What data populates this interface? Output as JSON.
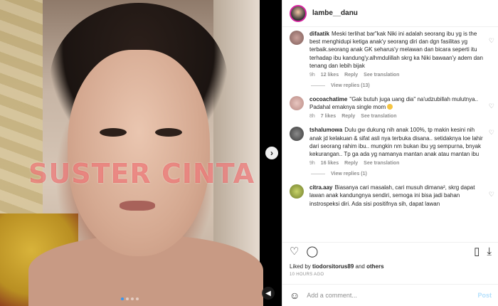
{
  "media": {
    "watermark": "SUSTER CINTA",
    "next_icon": "chevron-right-icon",
    "mute_icon": "speaker-muted-icon",
    "carousel_dots": 4,
    "active_dot": 0
  },
  "header": {
    "username": "lambe__danu"
  },
  "comments": [
    {
      "user": "difaatik",
      "text": "Meski terlihat bar\"kak Niki ini adalah seorang ibu yg is the best menghidupi ketiga anak'y seorang diri dan dgn fasilitas yg terbaik.seorang anak GK seharus'y melawan dan bicara seperti itu terhadap ibu kandung'y.alhmdulillah skrg ka Niki bawaan'y adem dan tenang dan lebih bijak",
      "time": "9h",
      "likes": "12 likes",
      "reply": "Reply",
      "translate": "See translation",
      "view_replies": "View replies (13)"
    },
    {
      "user": "cocoachatime",
      "text": "\"Gak butuh juga uang dia\" na'udzubillah mulutnya.. Padahal emaknya single mom",
      "time": "8h",
      "likes": "7 likes",
      "reply": "Reply",
      "translate": "See translation",
      "view_replies": ""
    },
    {
      "user": "tshalumowa",
      "text": "Dulu gw dukung nih anak 100%, tp makin kesini nih anak jd kelakuan & sifat asli nya terbuka disana.. setidaknya loe lahir dari seorang rahim ibu.. mungkin nm bukan ibu yg sempurna, bnyak kekurangan.. Tp ga ada yg namanya mantan anak atau mantan ibu",
      "time": "9h",
      "likes": "16 likes",
      "reply": "Reply",
      "translate": "See translation",
      "view_replies": "View replies (1)"
    },
    {
      "user": "citra.aay",
      "text": "Biasanya cari masalah, cari musuh dimana², skrg dapat lawan anak kandungnya sendiri, semoga ini bisa jadi bahan instrospeksi diri. Ada sisi positifnya sih, dapat lawan",
      "time": "",
      "likes": "",
      "reply": "",
      "translate": "",
      "view_replies": ""
    }
  ],
  "actions": {
    "like_icon": "heart-icon",
    "comment_icon": "comment-icon",
    "save_icon": "bookmark-icon",
    "share_icon": "share-icon"
  },
  "likes": {
    "prefix": "Liked by",
    "user": "tiodorsitorus89",
    "joiner": "and",
    "others": "others"
  },
  "timestamp": "10 HOURS AGO",
  "add_comment": {
    "placeholder": "Add a comment...",
    "post": "Post"
  },
  "colors": {
    "accent": "#0095f6",
    "watermark": "#e64646",
    "muted_text": "#8e8e8e"
  }
}
